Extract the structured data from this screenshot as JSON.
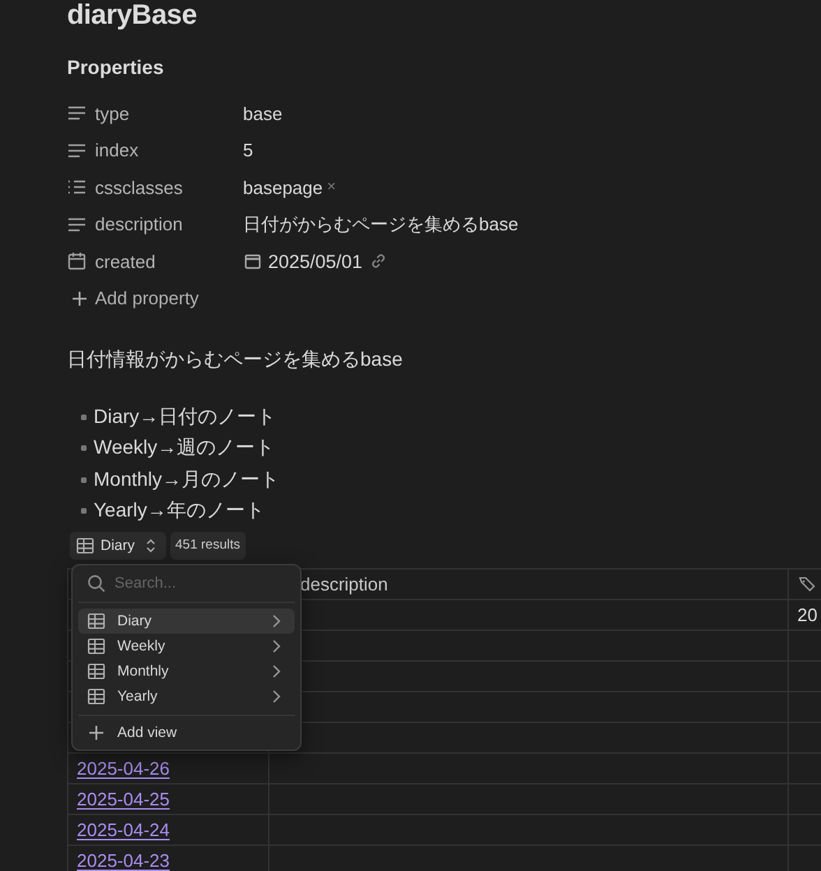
{
  "title": "diaryBase",
  "properties": {
    "heading": "Properties",
    "items": [
      {
        "kind": "text",
        "name": "type",
        "value": "base"
      },
      {
        "kind": "text",
        "name": "index",
        "value": "5"
      },
      {
        "kind": "list",
        "name": "cssclasses",
        "value": "basepage",
        "remove": "×"
      },
      {
        "kind": "text",
        "name": "description",
        "value": "日付がからむページを集めるbase"
      },
      {
        "kind": "date",
        "name": "created",
        "value": "2025/05/01"
      }
    ],
    "add": "Add property"
  },
  "paragraph": "日付情報がからむページを集めるbase",
  "bullets": [
    "Diary→日付のノート",
    "Weekly→週のノート",
    "Monthly→月のノート",
    "Yearly→年のノート"
  ],
  "toolbar": {
    "view": "Diary",
    "results": "451 results"
  },
  "view_menu": {
    "search": {
      "placeholder": "Search..."
    },
    "views": [
      {
        "label": "Diary",
        "selected": true
      },
      {
        "label": "Weekly",
        "selected": false
      },
      {
        "label": "Monthly",
        "selected": false
      },
      {
        "label": "Yearly",
        "selected": false
      }
    ],
    "add": "Add view"
  },
  "table": {
    "column_2": "description",
    "rows": [
      {
        "column_3": "20"
      },
      {},
      {},
      {},
      {},
      {
        "file": "2025-04-26"
      },
      {
        "file": "2025-04-25"
      },
      {
        "file": "2025-04-24"
      },
      {
        "file": "2025-04-23"
      }
    ]
  }
}
